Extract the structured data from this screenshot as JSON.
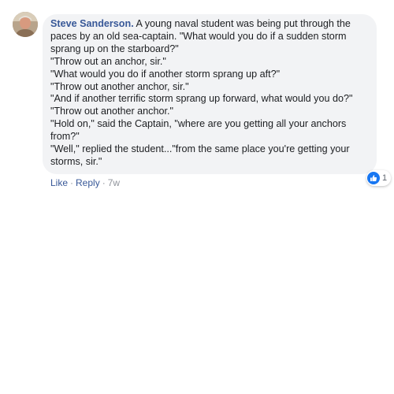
{
  "comment": {
    "author": "Steve Sanderson.",
    "lines": [
      " A young naval student was being put through the",
      "paces by an old sea-captain. \"What would you do if a sudden storm",
      "sprang up on the starboard?\"",
      "\"Throw out an anchor, sir.\"",
      "\"What would you do if another storm sprang up aft?\"",
      "\"Throw out another anchor, sir.\"",
      "\"And if another terrific storm sprang up forward, what would you do?\"",
      "\"Throw out another anchor.\"",
      "\"Hold on,\" said the Captain, \"where are you getting all your anchors",
      "from?\"",
      "\"Well,\" replied the student...\"from the same place you're getting your",
      "storms, sir.\""
    ],
    "reaction_count": "1",
    "reaction_icon": "thumbs-up-icon",
    "accent_color": "#385898"
  },
  "actions": {
    "like": "Like",
    "separator": "·",
    "reply": "Reply",
    "time": "7w"
  }
}
